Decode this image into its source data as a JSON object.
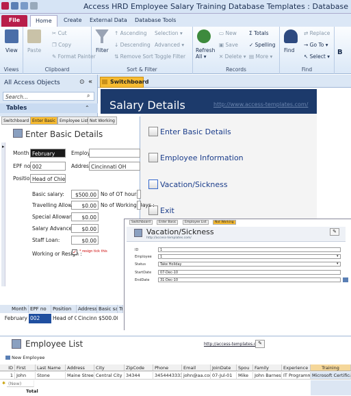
{
  "app": {
    "title": "Access HRD Employee Salary Training Database Templates : Database"
  },
  "ribbon_tabs": [
    "File",
    "Home",
    "Create",
    "External Data",
    "Database Tools"
  ],
  "ribbon": {
    "views": {
      "view_label": "View",
      "group": "Views"
    },
    "clipboard": {
      "paste": "Paste",
      "cut": "Cut",
      "copy": "Copy",
      "format_painter": "Format Painter",
      "group": "Clipboard"
    },
    "sort_filter": {
      "filter": "Filter",
      "ascending": "Ascending",
      "descending": "Descending",
      "remove_sort": "Remove Sort",
      "selection": "Selection",
      "advanced": "Advanced",
      "toggle_filter": "Toggle Filter",
      "group": "Sort & Filter"
    },
    "records": {
      "refresh": "Refresh",
      "refresh_all": "All",
      "new": "New",
      "save": "Save",
      "delete": "Delete",
      "totals": "Totals",
      "spelling": "Spelling",
      "more": "More",
      "group": "Records"
    },
    "find": {
      "find": "Find",
      "replace": "Replace",
      "goto": "Go To",
      "select": "Select",
      "group": "Find"
    }
  },
  "nav_pane": {
    "title": "All Access Objects",
    "search_placeholder": "Search...",
    "section": "Tables"
  },
  "document_tab": "Switchboard",
  "switchboard": {
    "title": "Salary Details",
    "url": "http://www.access-templates.com/",
    "items": [
      "Enter Basic Details",
      "Employee Information",
      "Vacation/Sickness",
      "Exit"
    ]
  },
  "form_tabs": [
    "Switchboard",
    "Enter Basic",
    "Employee List",
    "Not Working"
  ],
  "basic_form": {
    "title": "Enter Basic Details",
    "month_label": "Month :",
    "month": "February",
    "employee_label": "Employee:",
    "epf_label": "EPF no :",
    "epf": "002",
    "address_label": "Address:",
    "address": "Cincinnati OH",
    "position_label": "Position:",
    "position": "Head of Chief",
    "basic_salary_label": "Basic salary:",
    "basic_salary": "$500.00",
    "travelling_label": "Travelling Allowance:",
    "travelling": "$0.00",
    "special_label": "Special Allowance:",
    "special": "$0.00",
    "salary_adv_label": "Salary Advance:",
    "salary_adv": "$0.00",
    "staff_loan_label": "Staff Loan:",
    "staff_loan": "$0.00",
    "ot_hours_label": "No of OT hours:",
    "working_days_label": "No of Working Days :",
    "working_label": "Working or Resign :",
    "resign_note": "* resign tick this"
  },
  "datasheet": {
    "headers": [
      "Month",
      "EPF no",
      "Position",
      "Address",
      "Basic sala",
      "Tr"
    ],
    "row": [
      "February",
      "002",
      "Head of Chief",
      "Cincinnati",
      "$500.00",
      ""
    ]
  },
  "vacation_form": {
    "tabs": [
      "Switchboard",
      "Enter Basic",
      "Employee List",
      "Not Working"
    ],
    "title": "Vacation/Sickness",
    "url": "http://access-templates.com/",
    "labels": [
      "ID",
      "Employee",
      "Status",
      "StartDate",
      "EndDate"
    ],
    "values": [
      "1",
      "1",
      "Take Holiday",
      "07-Dec-10",
      "31-Dec-10"
    ]
  },
  "employee_list": {
    "title": "Employee List",
    "url": "http://access-templates.com/",
    "new_label": "New Employee",
    "headers": [
      "ID",
      "First",
      "Last Name",
      "Address",
      "City",
      "ZipCode",
      "Phone",
      "Email",
      "JoinDate",
      "Spou",
      "Family",
      "Experience",
      "Training"
    ],
    "row": [
      "1",
      "John",
      "Stone",
      "Maine Street",
      "Central City",
      "34344",
      "3454443333",
      "john@aa.com",
      "07-Jul-01",
      "Mike",
      "John Barnes",
      "IT Programmer",
      "Microsoft Certification"
    ],
    "new_row": "(New)",
    "total": "Total"
  },
  "colors": {
    "file_tab": "#b81e4a",
    "switchboard_header": "#1c3a6b",
    "tab_active": "#f7bb31",
    "link": "#1a3c8a"
  }
}
